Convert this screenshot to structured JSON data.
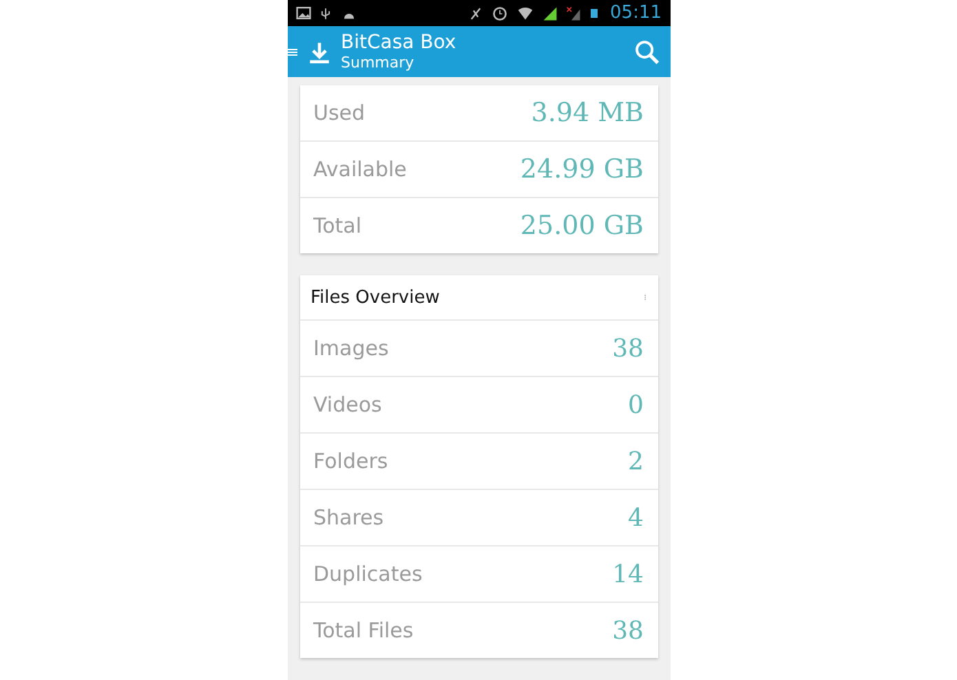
{
  "status_bar": {
    "time": "05:11"
  },
  "app_bar": {
    "title": "BitCasa Box",
    "subtitle": "Summary"
  },
  "storage": [
    {
      "label": "Used",
      "value": "3.94 MB"
    },
    {
      "label": "Available",
      "value": "24.99 GB"
    },
    {
      "label": "Total",
      "value": "25.00 GB"
    }
  ],
  "files_overview": {
    "title": "Files Overview",
    "rows": [
      {
        "label": "Images",
        "value": "38"
      },
      {
        "label": "Videos",
        "value": "0"
      },
      {
        "label": "Folders",
        "value": "2"
      },
      {
        "label": "Shares",
        "value": "4"
      },
      {
        "label": "Duplicates",
        "value": "14"
      },
      {
        "label": "Total Files",
        "value": "38"
      }
    ]
  }
}
